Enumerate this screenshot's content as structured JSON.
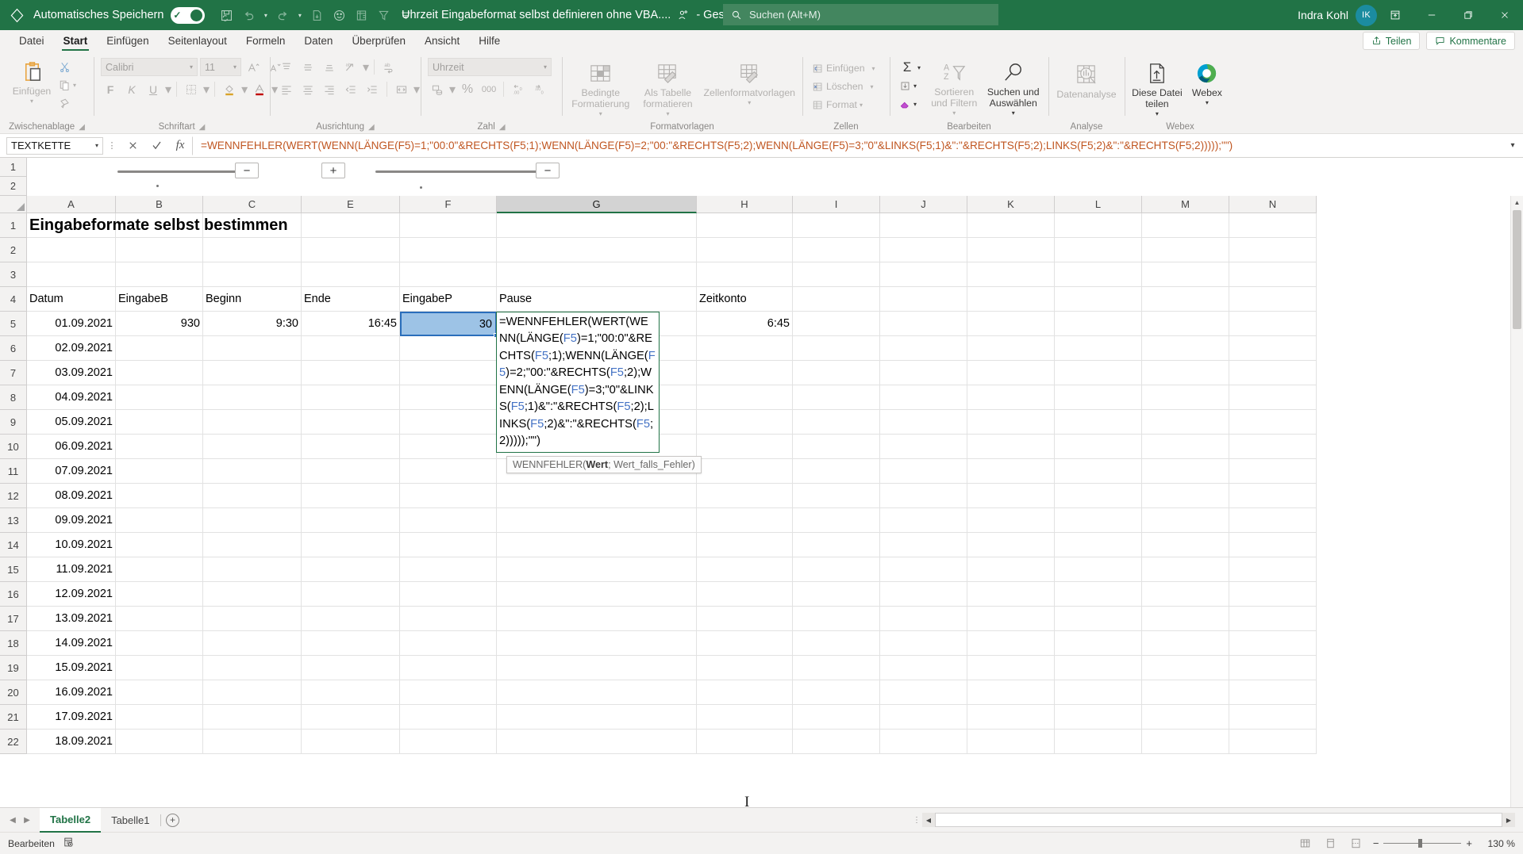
{
  "titlebar": {
    "autosave_label": "Automatisches Speichern",
    "autosave_state": "Ein",
    "document_title": "Uhrzeit Eingabeformat selbst definieren ohne VBA....",
    "save_status": "- Gespeichert",
    "search_placeholder": "Suchen (Alt+M)",
    "user_name": "Indra Kohl",
    "user_initials": "IK",
    "qat": [
      "save-refresh-icon",
      "undo-icon",
      "redo-icon",
      "export-pdf-icon",
      "emoji-icon",
      "tablet-icon",
      "filter-icon",
      "customize-qat-icon"
    ],
    "window_buttons": [
      "ribbon-display-options",
      "minimize",
      "restore",
      "close"
    ],
    "accent": "#217346"
  },
  "ribbon": {
    "tabs": [
      {
        "label": "Datei",
        "active": false
      },
      {
        "label": "Start",
        "active": true
      },
      {
        "label": "Einfügen",
        "active": false
      },
      {
        "label": "Seitenlayout",
        "active": false
      },
      {
        "label": "Formeln",
        "active": false
      },
      {
        "label": "Daten",
        "active": false
      },
      {
        "label": "Überprüfen",
        "active": false
      },
      {
        "label": "Ansicht",
        "active": false
      },
      {
        "label": "Hilfe",
        "active": false
      }
    ],
    "share_label": "Teilen",
    "comments_label": "Kommentare",
    "groups": {
      "clipboard": {
        "title": "Zwischenablage",
        "paste_label": "Einfügen",
        "cut_label": "",
        "copy_label": "",
        "format_painter_label": ""
      },
      "font": {
        "title": "Schriftart",
        "font_name": "Calibri",
        "font_size": "11",
        "bold": "F",
        "italic": "K",
        "underline": "U"
      },
      "alignment": {
        "title": "Ausrichtung"
      },
      "number": {
        "title": "Zahl",
        "format": "Uhrzeit",
        "percent": "%",
        "thousands": "000"
      },
      "styles": {
        "title": "Formatvorlagen",
        "conditional": "Bedingte Formatierung",
        "as_table": "Als Tabelle formatieren",
        "cell_styles": "Zellenformatvorlagen"
      },
      "cells": {
        "title": "Zellen",
        "insert": "Einfügen",
        "delete": "Löschen",
        "format": "Format"
      },
      "editing": {
        "title": "Bearbeiten",
        "sum": "Σ",
        "sort_filter": "Sortieren und Filtern",
        "find_select": "Suchen und Auswählen"
      },
      "analysis": {
        "title": "Analyse",
        "data_analysis": "Datenanalyse"
      },
      "webex": {
        "title": "Webex",
        "share_file": "Diese Datei teilen",
        "webex": "Webex"
      }
    }
  },
  "formula_bar": {
    "name_box": "TEXTKETTE",
    "cancel_icon": "cancel-icon",
    "accept_icon": "accept-icon",
    "function_icon": "fx-icon",
    "formula": "=WENNFEHLER(WERT(WENN(LÄNGE(F5)=1;\"00:0\"&RECHTS(F5;1);WENN(LÄNGE(F5)=2;\"00:\"&RECHTS(F5;2);WENN(LÄNGE(F5)=3;\"0\"&LINKS(F5;1)&\":\"&RECHTS(F5;2);LINKS(F5;2)&\":\"&RECHTS(F5;2)))));\"\")",
    "expand_icon": "chevron-down-icon"
  },
  "grid": {
    "column_headers": [
      "A",
      "B",
      "C",
      "E",
      "F",
      "G",
      "H",
      "I",
      "J",
      "K",
      "L",
      "M",
      "N"
    ],
    "selected_column": "G",
    "row_headers": [
      "1",
      "2",
      "3",
      "4",
      "5",
      "6",
      "7",
      "8",
      "9",
      "10",
      "11",
      "12",
      "13",
      "14",
      "15",
      "16",
      "17",
      "18",
      "19",
      "20",
      "21",
      "22"
    ],
    "title_cell": "Eingabeformate selbst bestimmen",
    "headers_row4": {
      "A": "Datum",
      "B": "EingabeB",
      "C": "Beginn",
      "E": "Ende",
      "F": "EingabeP",
      "G": "Pause",
      "H": "Zeitkonto"
    },
    "row5": {
      "A": "01.09.2021",
      "B": "930",
      "C": "9:30",
      "E": "16:45",
      "F": "30",
      "H": "6:45"
    },
    "dates_column_a": [
      "01.09.2021",
      "02.09.2021",
      "03.09.2021",
      "04.09.2021",
      "05.09.2021",
      "06.09.2021",
      "07.09.2021",
      "08.09.2021",
      "09.09.2021",
      "10.09.2021",
      "11.09.2021",
      "12.09.2021",
      "13.09.2021",
      "14.09.2021",
      "15.09.2021",
      "16.09.2021",
      "17.09.2021",
      "18.09.2021"
    ],
    "selected_cell": "F5",
    "editing_cell": "G5",
    "editing_tokens": [
      {
        "t": "=WENNFEHLER(",
        "c": "c-blk"
      },
      {
        "t": "WERT(",
        "c": "c-blk"
      },
      {
        "t": "WENN(",
        "c": "c-blk"
      },
      {
        "t": "LÄNGE(",
        "c": "c-blk"
      },
      {
        "t": "F5",
        "c": "c-blu"
      },
      {
        "t": ")=1;\"00:0\"&RECHTS(",
        "c": "c-blk"
      },
      {
        "t": "F5",
        "c": "c-blu"
      },
      {
        "t": ";1);WENN(",
        "c": "c-blk"
      },
      {
        "t": "LÄNGE(",
        "c": "c-blk"
      },
      {
        "t": "F5",
        "c": "c-blu"
      },
      {
        "t": ")=2;\"00:\"&RECHTS(",
        "c": "c-blk"
      },
      {
        "t": "F5",
        "c": "c-blu"
      },
      {
        "t": ";2);WENN(",
        "c": "c-blk"
      },
      {
        "t": "LÄNGE(",
        "c": "c-blk"
      },
      {
        "t": "F5",
        "c": "c-blu"
      },
      {
        "t": ")=3;\"0\"&LINKS(",
        "c": "c-blk"
      },
      {
        "t": "F5",
        "c": "c-blu"
      },
      {
        "t": ";1)&\":\"&RECHTS(",
        "c": "c-blk"
      },
      {
        "t": "F5",
        "c": "c-blu"
      },
      {
        "t": ";2);",
        "c": "c-blk"
      },
      {
        "t": "LINKS(",
        "c": "c-blk"
      },
      {
        "t": "F5",
        "c": "c-blu"
      },
      {
        "t": ";2)&\":\"&",
        "c": "c-blk"
      },
      {
        "t": "RECHTS(",
        "c": "c-blk"
      },
      {
        "t": "F5",
        "c": "c-blu"
      },
      {
        "t": ";2)))));\"\")",
        "c": "c-blk"
      }
    ],
    "tooltip": {
      "func": "WENNFEHLER(",
      "arg_active": "Wert",
      "arg_rest": "; Wert_falls_Fehler)"
    }
  },
  "sheet_tabs": {
    "tabs": [
      {
        "label": "Tabelle2",
        "active": true
      },
      {
        "label": "Tabelle1",
        "active": false
      }
    ],
    "add_label": "+"
  },
  "status_bar": {
    "mode": "Bearbeiten",
    "accessibility_icon": "accessibility-icon",
    "views": [
      "normal-view-icon",
      "page-layout-icon",
      "page-break-icon"
    ],
    "zoom_out": "−",
    "zoom_in": "+",
    "zoom_level": "130 %"
  }
}
